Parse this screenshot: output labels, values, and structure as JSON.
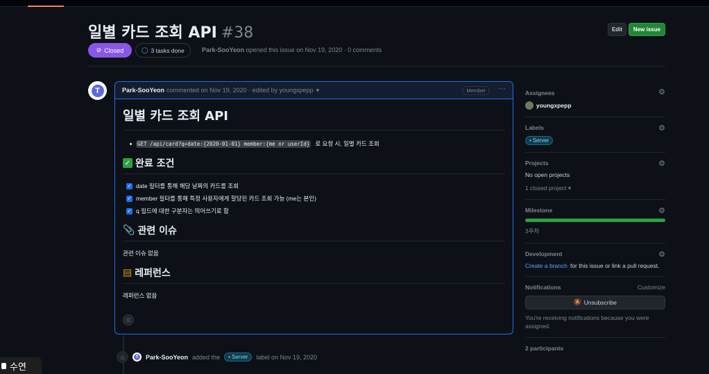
{
  "issue": {
    "title": "일별 카드 조회 API",
    "number": "#38",
    "state": "Closed",
    "tasks": "3 tasks done",
    "author": "Park-SooYeon",
    "opened_text": "opened this issue on Nov 19, 2020 · 0 comments"
  },
  "header_buttons": {
    "edit": "Edit",
    "new_issue": "New issue"
  },
  "comment": {
    "author": "Park-SooYeon",
    "meta": "commented on Nov 19, 2020 · edited by youngxpepp",
    "role": "Member",
    "more": "···",
    "heading": "일별 카드 조회 API",
    "bullet_code": "GET /api/card?q=date:{2020-01-01} member:{me or userId}",
    "bullet_text": "로 요청 시, 일별 카드 조회",
    "done_heading": "완료 조건",
    "tasks": [
      "date 필터를 통해 해당 날짜의 카드를 조회",
      "member 필터를 통해 특정 사용자에게 할당된 카드 조회 가능 (me는 본인)",
      "q 필드에 대한 구분자는 띄어쓰기로 함"
    ],
    "related_heading": "관련 이슈",
    "related_text": "관련 이슈 없음",
    "refs_heading": "레퍼런스",
    "refs_text": "레퍼런스 없음"
  },
  "event": {
    "author": "Park-SooYeon",
    "added": "added the",
    "label": "Server",
    "suffix": "label on Nov 19, 2020"
  },
  "sidebar": {
    "assignees_title": "Assignees",
    "assignee": "youngxpepp",
    "labels_title": "Labels",
    "label": "Server",
    "projects_title": "Projects",
    "projects_value": "No open projects",
    "closed_project": "1 closed project",
    "milestone_title": "Milestone",
    "milestone_value": "3주차",
    "milestone_progress": 1.0,
    "development_title": "Development",
    "dev_link": "Create a branch",
    "dev_text": "for this issue or link a pull request.",
    "notifications_title": "Notifications",
    "customize": "Customize",
    "unsubscribe": "Unsubscribe",
    "notif_text": "You're receiving notifications because you were assigned.",
    "participants": "2 participants"
  },
  "caption": "수연",
  "colors": {
    "closed": "#8957e5",
    "new_issue": "#238636",
    "link": "#58a6ff",
    "label_text": "#7fd3f0"
  }
}
